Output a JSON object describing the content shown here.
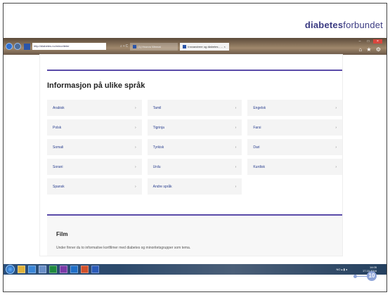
{
  "brand": {
    "bold": "diabetes",
    "rest": "forbundet"
  },
  "browser": {
    "address": "http://diabetes.no/minoriteter",
    "address_tools": "⌕ ▾ C",
    "tabs": [
      {
        "label": "(1) Hvorvo Wemat",
        "active": false
      },
      {
        "label": "Innvandrere og diabetes - ...  ×",
        "active": true
      }
    ],
    "win_controls": {
      "minimize": "–",
      "maximize": "□",
      "close": "×"
    },
    "toolbar_icons": "⌂ ★ ⚙"
  },
  "page": {
    "heading": "Informasjon på ulike språk",
    "languages": [
      [
        "Arabisk",
        "Tamil",
        "Engelsk"
      ],
      [
        "Polsk",
        "Tigrinja",
        "Farsi"
      ],
      [
        "Somali",
        "Tyrkisk",
        "Dari"
      ],
      [
        "Sorani",
        "Urdu",
        "Kurdisk"
      ],
      [
        "Spansk",
        "Andre språk",
        ""
      ]
    ],
    "chevron": "›",
    "film": {
      "title": "Film",
      "description": "Under finner du to informative kortfilmer med diabetes og minoritetsgrupper som tema."
    }
  },
  "taskbar": {
    "apps": [
      {
        "name": "explorer",
        "color": "#e0b23a"
      },
      {
        "name": "ie",
        "color": "#3a86d8"
      },
      {
        "name": "media",
        "color": "#6a8fc8"
      },
      {
        "name": "excel",
        "color": "#1f8a3e"
      },
      {
        "name": "onenote",
        "color": "#7b3aa8"
      },
      {
        "name": "outlook",
        "color": "#1f6fc8"
      },
      {
        "name": "powerpoint",
        "color": "#d2502a"
      },
      {
        "name": "word",
        "color": "#2a5ab8"
      }
    ],
    "tray_icons": "NO  ▴  ▮  ◂",
    "time": "14:05",
    "date": "17.10.2016"
  },
  "slide_number": "10"
}
